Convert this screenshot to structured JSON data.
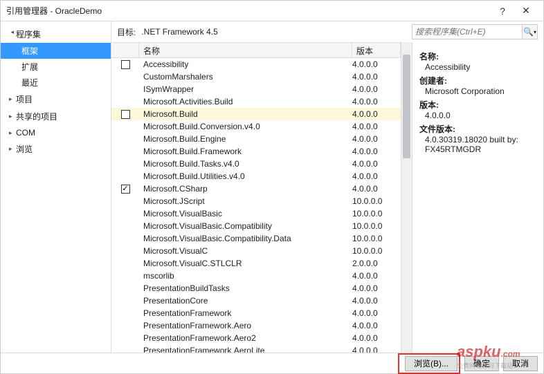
{
  "title": "引用管理器 - OracleDemo",
  "sidebar": {
    "groups": [
      {
        "label": "程序集",
        "expanded": true,
        "children": [
          {
            "label": "框架",
            "selected": true
          },
          {
            "label": "扩展"
          },
          {
            "label": "最近"
          }
        ]
      },
      {
        "label": "项目",
        "expanded": false
      },
      {
        "label": "共享的项目",
        "expanded": false
      },
      {
        "label": "COM",
        "expanded": false
      },
      {
        "label": "浏览",
        "expanded": false
      }
    ]
  },
  "target": {
    "label": "目标:",
    "value": ".NET Framework 4.5"
  },
  "search": {
    "placeholder": "搜索程序集(Ctrl+E)"
  },
  "columns": {
    "name": "名称",
    "version": "版本"
  },
  "items": [
    {
      "name": "Accessibility",
      "version": "4.0.0.0",
      "showCheckbox": true,
      "checked": false
    },
    {
      "name": "CustomMarshalers",
      "version": "4.0.0.0"
    },
    {
      "name": "ISymWrapper",
      "version": "4.0.0.0"
    },
    {
      "name": "Microsoft.Activities.Build",
      "version": "4.0.0.0"
    },
    {
      "name": "Microsoft.Build",
      "version": "4.0.0.0",
      "showCheckbox": true,
      "checked": false,
      "hover": true
    },
    {
      "name": "Microsoft.Build.Conversion.v4.0",
      "version": "4.0.0.0"
    },
    {
      "name": "Microsoft.Build.Engine",
      "version": "4.0.0.0"
    },
    {
      "name": "Microsoft.Build.Framework",
      "version": "4.0.0.0"
    },
    {
      "name": "Microsoft.Build.Tasks.v4.0",
      "version": "4.0.0.0"
    },
    {
      "name": "Microsoft.Build.Utilities.v4.0",
      "version": "4.0.0.0"
    },
    {
      "name": "Microsoft.CSharp",
      "version": "4.0.0.0",
      "showCheckbox": true,
      "checked": true
    },
    {
      "name": "Microsoft.JScript",
      "version": "10.0.0.0"
    },
    {
      "name": "Microsoft.VisualBasic",
      "version": "10.0.0.0"
    },
    {
      "name": "Microsoft.VisualBasic.Compatibility",
      "version": "10.0.0.0"
    },
    {
      "name": "Microsoft.VisualBasic.Compatibility.Data",
      "version": "10.0.0.0"
    },
    {
      "name": "Microsoft.VisualC",
      "version": "10.0.0.0"
    },
    {
      "name": "Microsoft.VisualC.STLCLR",
      "version": "2.0.0.0"
    },
    {
      "name": "mscorlib",
      "version": "4.0.0.0"
    },
    {
      "name": "PresentationBuildTasks",
      "version": "4.0.0.0"
    },
    {
      "name": "PresentationCore",
      "version": "4.0.0.0"
    },
    {
      "name": "PresentationFramework",
      "version": "4.0.0.0"
    },
    {
      "name": "PresentationFramework.Aero",
      "version": "4.0.0.0"
    },
    {
      "name": "PresentationFramework.Aero2",
      "version": "4.0.0.0"
    },
    {
      "name": "PresentationFramework.AeroLite",
      "version": "4.0.0.0"
    }
  ],
  "details": {
    "name_label": "名称:",
    "name_value": "Accessibility",
    "creator_label": "创建者:",
    "creator_value": "Microsoft Corporation",
    "version_label": "版本:",
    "version_value": "4.0.0.0",
    "filever_label": "文件版本:",
    "filever_value1": "4.0.30319.18020 built by:",
    "filever_value2": "FX45RTMGDR"
  },
  "footer": {
    "browse": "浏览(B)...",
    "ok": "确定",
    "cancel": "取消"
  },
  "watermark": {
    "line1": "aspku",
    "line2": "免费网站源码下载站！",
    "line3": ".com"
  }
}
